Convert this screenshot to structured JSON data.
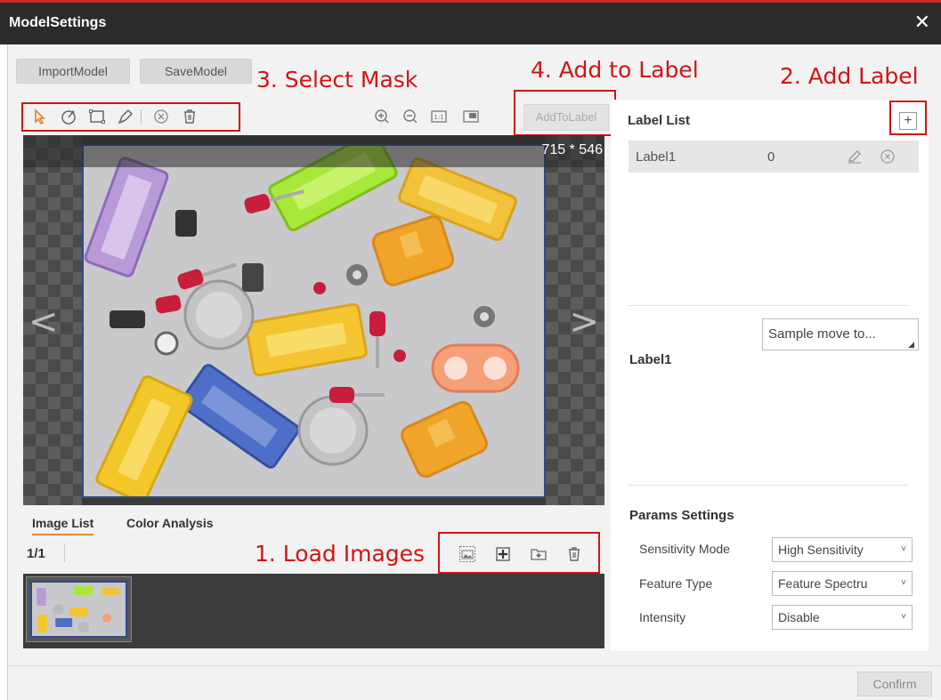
{
  "window": {
    "title": "ModelSettings",
    "close_glyph": "✕"
  },
  "toolbar": {
    "import_label": "ImportModel",
    "save_label": "SaveModel",
    "add_to_label": "AddToLabel"
  },
  "annotations": {
    "select_mask": "3. Select Mask",
    "add_to_label": "4. Add to Label",
    "add_label": "2. Add Label",
    "load_images": "1. Load Images",
    "color": "#d01515"
  },
  "viewer": {
    "dimensions": "715 * 546",
    "prev_arrow": "<",
    "next_arrow": ">"
  },
  "mask_tools": [
    "pointer-icon",
    "circle-select-icon",
    "rect-select-icon",
    "polygon-pen-icon",
    "clear-icon",
    "delete-icon"
  ],
  "view_tools": [
    "zoom-in-icon",
    "zoom-out-icon",
    "actual-size-icon",
    "fit-window-icon"
  ],
  "image_tabs": {
    "image_list": "Image List",
    "color_analysis": "Color Analysis",
    "accent": "#e08a3a"
  },
  "image_list": {
    "counter": "1/1",
    "tools": [
      "load-images-icon",
      "add-image-icon",
      "add-folder-icon",
      "delete-images-icon"
    ]
  },
  "label_panel": {
    "title": "Label List",
    "add_glyph": "+",
    "labels": [
      {
        "name": "Label1",
        "count": "0"
      }
    ],
    "selected_label": "Label1",
    "move_select": "Sample move to..."
  },
  "params": {
    "title": "Params Settings",
    "rows": [
      {
        "label": "Sensitivity Mode",
        "value": "High Sensitivity"
      },
      {
        "label": "Feature Type",
        "value": "Feature Spectru"
      },
      {
        "label": "Intensity",
        "value": "Disable"
      }
    ]
  },
  "footer": {
    "confirm_label": "Confirm"
  }
}
